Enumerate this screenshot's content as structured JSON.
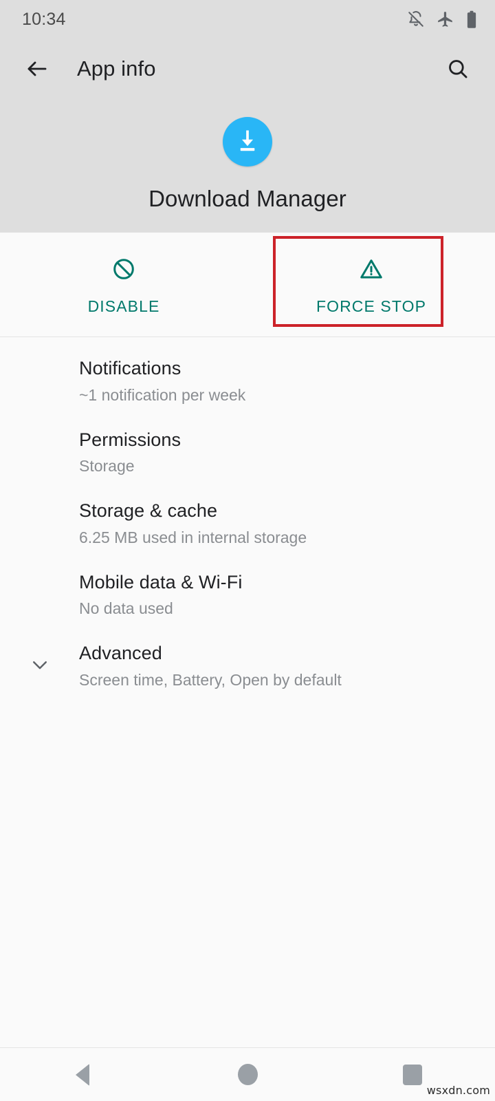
{
  "status_bar": {
    "time": "10:34",
    "icons": [
      {
        "name": "notifications-off-icon"
      },
      {
        "name": "airplane-mode-icon"
      },
      {
        "name": "battery-icon"
      }
    ]
  },
  "app_bar": {
    "back_icon": "back-arrow-icon",
    "title": "App info",
    "search_icon": "search-icon"
  },
  "app_identity": {
    "icon_name": "download-manager-icon",
    "icon_color": "#29b6f6",
    "name": "Download Manager"
  },
  "actions": {
    "accent_color": "#00796b",
    "highlight_color": "#cc2229",
    "buttons": [
      {
        "label": "DISABLE",
        "icon": "block-circle-slash-icon",
        "highlighted": false
      },
      {
        "label": "FORCE STOP",
        "icon": "warning-triangle-icon",
        "highlighted": true
      }
    ]
  },
  "settings": {
    "items": [
      {
        "title": "Notifications",
        "summary": "~1 notification per week",
        "leading_icon": ""
      },
      {
        "title": "Permissions",
        "summary": "Storage",
        "leading_icon": ""
      },
      {
        "title": "Storage & cache",
        "summary": "6.25 MB used in internal storage",
        "leading_icon": ""
      },
      {
        "title": "Mobile data & Wi-Fi",
        "summary": "No data used",
        "leading_icon": ""
      },
      {
        "title": "Advanced",
        "summary": "Screen time, Battery, Open by default",
        "leading_icon": "chevron-down-icon"
      }
    ]
  },
  "nav_bar": {
    "back_label": "back-button",
    "home_label": "home-button",
    "recents_label": "recents-button"
  },
  "watermark": {
    "text": "wsxdn.com"
  }
}
